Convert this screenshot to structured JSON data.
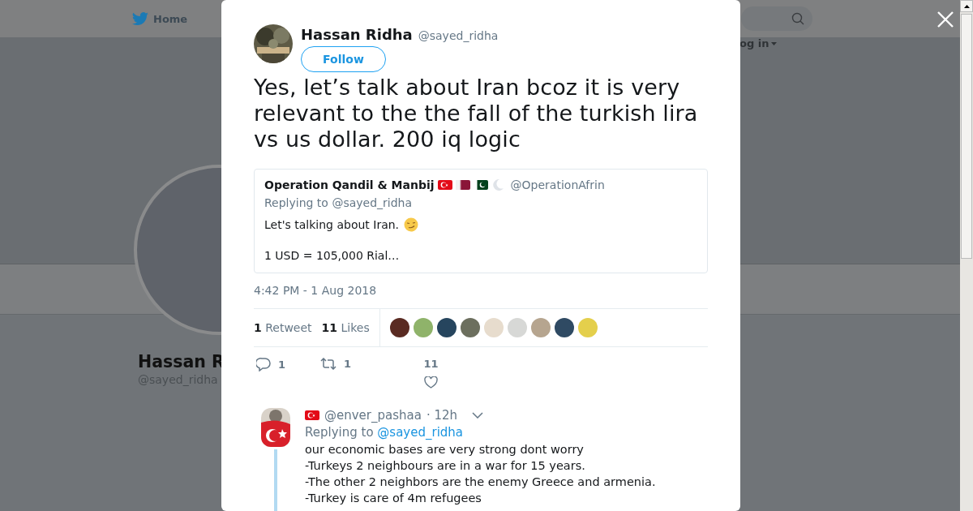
{
  "background_page": {
    "nav": {
      "home_label": "Home",
      "login_label": "og in"
    },
    "profile": {
      "name": "Hassan R",
      "handle": "@sayed_ridha"
    }
  },
  "tweet_modal": {
    "author": {
      "name": "Hassan Ridha",
      "handle": "@sayed_ridha"
    },
    "follow_button": "Follow",
    "text": "Yes, let’s talk about Iran bcoz it is very relevant to the the fall of the turkish lira vs us dollar. 200 iq logic",
    "quoted_tweet": {
      "name": "Operation Qandil & Manbij",
      "handle": "@OperationAfrin",
      "replying_to": "Replying to @sayed_ridha",
      "lines": [
        "Let's talking about Iran.",
        "1 USD = 105,000 Rial…"
      ]
    },
    "timestamp": "4:42 PM - 1 Aug 2018",
    "stats": [
      {
        "count": "1",
        "label": "Retweet"
      },
      {
        "count": "11",
        "label": "Likes"
      }
    ],
    "actions": [
      {
        "kind": "reply",
        "count": "1"
      },
      {
        "kind": "retweet",
        "count": "1"
      },
      {
        "kind": "like",
        "count": "11"
      }
    ],
    "reply": {
      "handle": "@enver_pashaa",
      "time": "· 12h",
      "replying_to_label": "Replying to",
      "replying_to_link": "@sayed_ridha",
      "text": "our economic bases are very strong dont worry\n-Turkeys 2 neighbours are in a war for 15 years.\n-The other 2 neighbors are the enemy Greece and armenia.\n-Turkey is care of 4m refugees"
    }
  }
}
